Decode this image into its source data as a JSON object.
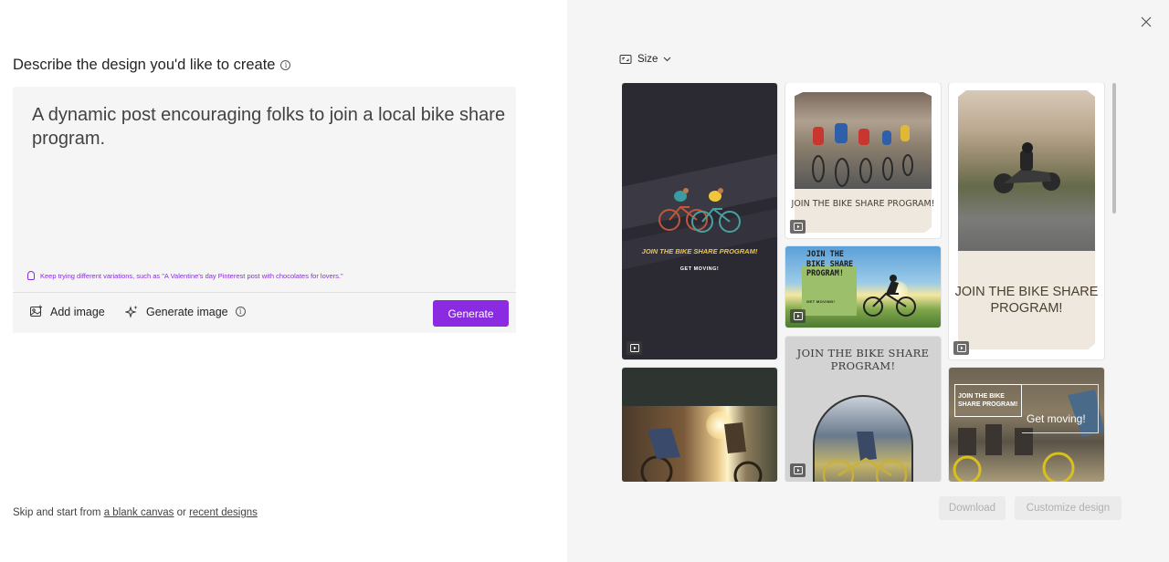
{
  "left": {
    "heading": "Describe the design you'd like to create",
    "prompt": "A dynamic post encouraging folks to join a local bike share program.",
    "tip": "Keep trying different variations, such as \"A Valentine's day Pinterest post with chocolates for lovers.\"",
    "add_image": "Add image",
    "generate_image": "Generate image",
    "generate": "Generate",
    "skip_prefix": "Skip and start from",
    "blank_canvas": "a blank canvas",
    "or": "or",
    "recent_designs": "recent designs"
  },
  "right": {
    "size_label": "Size",
    "download": "Download",
    "customize": "Customize design",
    "cards": {
      "c1_title": "JOIN THE BIKE SHARE PROGRAM!",
      "c1_sub": "GET MOVING!",
      "c2_title": "JOIN THE BIKE SHARE PROGRAM!",
      "c3_title": "JOIN THE BIKE SHARE PROGRAM!",
      "c3_sub": "GET MOVING!",
      "c4_title": "JOIN THE BIKE SHARE PROGRAM!",
      "c6_title": "JOIN THE BIKE SHARE PROGRAM!",
      "c7_title": "JOIN THE BIKE SHARE PROGRAM!",
      "c7_sub": "Get moving!"
    }
  },
  "colors": {
    "accent": "#8a2be2",
    "panel_bg": "#f5f5f5"
  }
}
